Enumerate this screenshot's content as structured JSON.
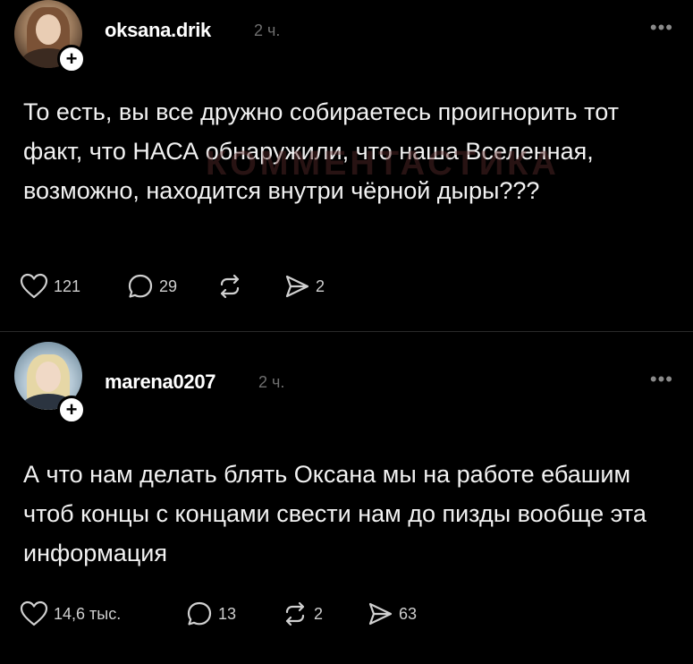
{
  "posts": [
    {
      "username": "oksana.drik",
      "time": "2 ч.",
      "more": "•••",
      "follow": "+",
      "text": "То есть, вы все дружно собираетесь проигнорить тот факт, что НАСА обнаружили, что наша Вселенная, возможно, находится внутри чёрной дыры???",
      "watermark": "КОММЕНТАСТИКА",
      "likes": "121",
      "comments": "29",
      "reposts": "",
      "shares": "2"
    },
    {
      "username": "marena0207",
      "time": "2 ч.",
      "more": "•••",
      "follow": "+",
      "text": "А что нам делать блять  Оксана мы на работе ебашим чтоб концы с концами свести нам до пизды вообще эта информация",
      "likes": "14,6 тыс.",
      "comments": "13",
      "reposts": "2",
      "shares": "63"
    }
  ],
  "icons": {
    "like": "heart-icon",
    "comment": "comment-icon",
    "repost": "repost-icon",
    "share": "share-icon"
  }
}
